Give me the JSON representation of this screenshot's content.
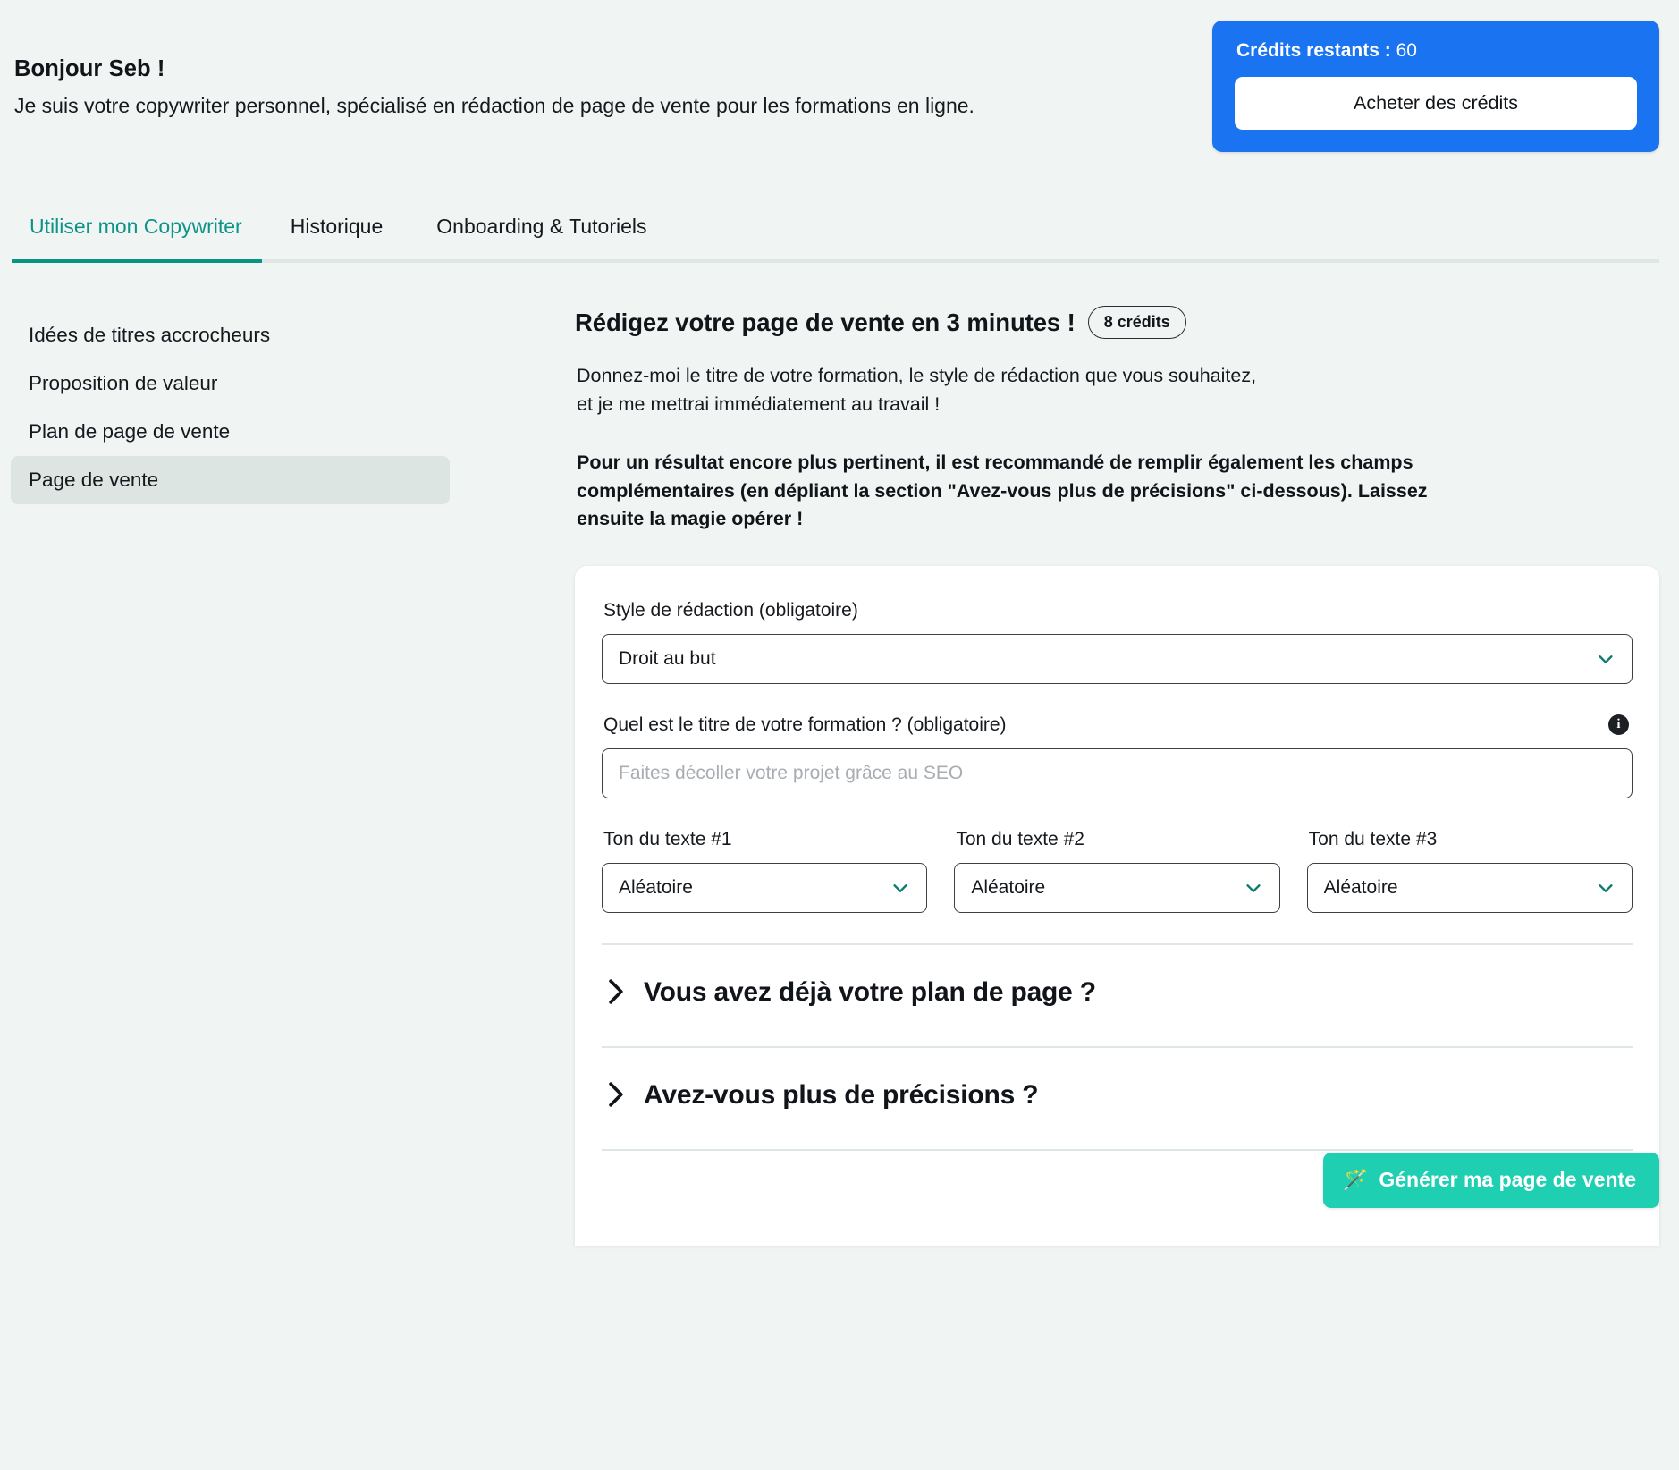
{
  "header": {
    "greeting_title": "Bonjour Seb !",
    "greeting_subtitle": "Je suis votre copywriter personnel, spécialisé en rédaction de page de vente pour les formations en ligne.",
    "credits": {
      "label": "Crédits restants :",
      "value": "60",
      "buy_label": "Acheter des crédits",
      "card_color": "#1a73f0"
    }
  },
  "tabs": [
    {
      "label": "Utiliser mon Copywriter",
      "active": true
    },
    {
      "label": "Historique",
      "active": false
    },
    {
      "label": "Onboarding & Tutoriels",
      "active": false
    }
  ],
  "tabs_accent": "#099383",
  "sidebar": {
    "items": [
      {
        "label": "Idées de titres accrocheurs",
        "active": false
      },
      {
        "label": "Proposition de valeur",
        "active": false
      },
      {
        "label": "Plan de page de vente",
        "active": false
      },
      {
        "label": "Page de vente",
        "active": true
      }
    ]
  },
  "main": {
    "title": "Rédigez votre page de vente en 3 minutes !",
    "credit_badge": "8 crédits",
    "intro_line_1": "Donnez-moi le titre de votre formation, le style de rédaction que vous souhaitez,",
    "intro_line_2": "et je me mettrai immédiatement au travail !",
    "intro_strong": "Pour un résultat encore plus pertinent, il est recommandé de remplir également les champs complémentaires (en dépliant la section \"Avez-vous plus de précisions\" ci-dessous). Laissez ensuite la magie opérer !"
  },
  "form": {
    "style": {
      "label": "Style de rédaction (obligatoire)",
      "value": "Droit au but"
    },
    "title_field": {
      "label": "Quel est le titre de votre formation ? (obligatoire)",
      "value": "",
      "placeholder": "Faites décoller votre projet grâce au SEO",
      "info_glyph": "i"
    },
    "tones": [
      {
        "label": "Ton du texte #1",
        "value": "Aléatoire"
      },
      {
        "label": "Ton du texte #2",
        "value": "Aléatoire"
      },
      {
        "label": "Ton du texte #3",
        "value": "Aléatoire"
      }
    ],
    "accordions": [
      {
        "title": "Vous avez déjà votre plan de page ?",
        "expanded": false
      },
      {
        "title": "Avez-vous plus de précisions ?",
        "expanded": false
      }
    ],
    "generate": {
      "label": "Générer ma page de vente",
      "icon": "🪄",
      "color": "#1fcfb2"
    }
  }
}
